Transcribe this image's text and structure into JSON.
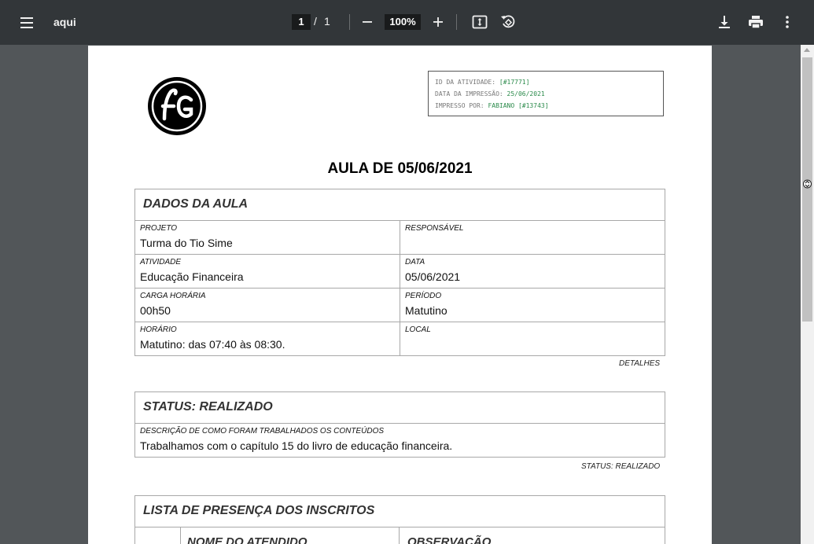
{
  "toolbar": {
    "title": "aqui",
    "current_page": "1",
    "page_sep": "/",
    "total_pages": "1",
    "zoom": "100%"
  },
  "icons": [
    "menu-icon",
    "zoom-out-icon",
    "zoom-in-icon",
    "fit-page-icon",
    "rotate-icon",
    "download-icon",
    "print-icon",
    "more-vert-icon"
  ],
  "info": {
    "id_label": "ID DA ATIVIDADE:",
    "id_value": "[#17771]",
    "date_label": "DATA DA IMPRESSÃO:",
    "date_value": "25/06/2021",
    "printed_label": "IMPRESSO POR:",
    "printed_value": "FABIANO [#13743]"
  },
  "title": "AULA DE 05/06/2021",
  "dados": {
    "heading": "DADOS DA AULA",
    "projeto_label": "PROJETO",
    "projeto_value": "Turma do Tio Sime",
    "responsavel_label": "RESPONSÁVEL",
    "responsavel_value": "",
    "atividade_label": "ATIVIDADE",
    "atividade_value": "Educação Financeira",
    "data_label": "DATA",
    "data_value": "05/06/2021",
    "carga_label": "CARGA HORÁRIA",
    "carga_value": "00h50",
    "periodo_label": "PERÍODO",
    "periodo_value": "Matutino",
    "horario_label": "HORÁRIO",
    "horario_value": "Matutino: das 07:40 às 08:30.",
    "local_label": "LOCAL",
    "local_value": "",
    "footer": "DETALHES"
  },
  "status": {
    "heading": "STATUS: REALIZADO",
    "desc_label": "DESCRIÇÃO DE COMO FORAM TRABALHADOS OS CONTEÚDOS",
    "desc_value": "Trabalhamos com o capítulo 15 do livro de educação financeira.",
    "footer": "STATUS: REALIZADO"
  },
  "presenca": {
    "heading": "LISTA DE PRESENÇA DOS INSCRITOS",
    "col_nome": "NOME DO ATENDIDO",
    "col_obs": "OBSERVAÇÃO"
  }
}
